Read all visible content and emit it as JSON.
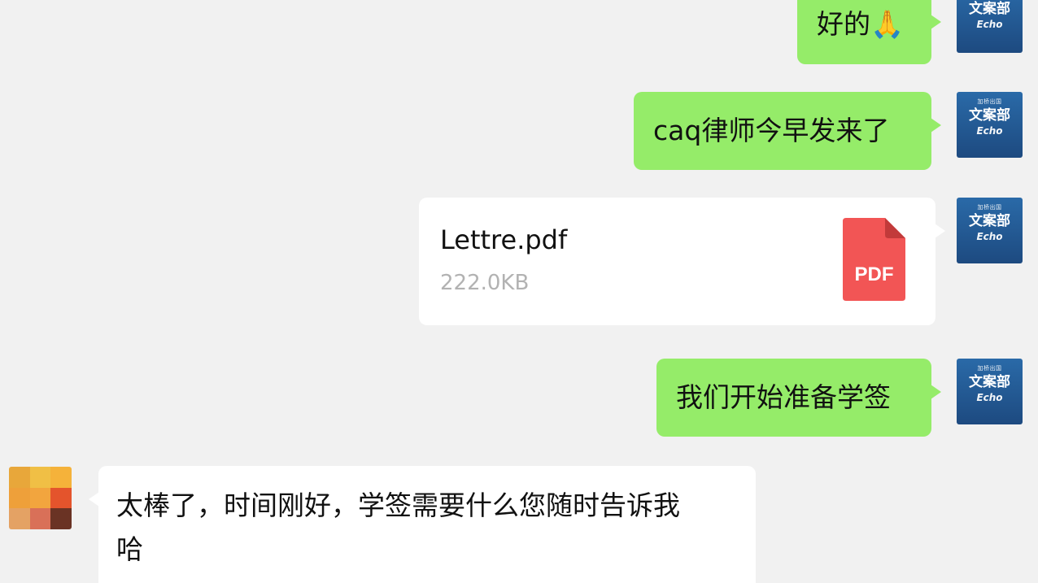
{
  "messages": {
    "m1": {
      "text": "好的",
      "emoji": "🙏"
    },
    "m2": {
      "text": "caq律师今早发来了"
    },
    "m3": {
      "file_name": "Lettre.pdf",
      "file_size": "222.0KB",
      "file_type": "PDF"
    },
    "m4": {
      "text": "我们开始准备学签"
    },
    "m5": {
      "line1": "太棒了，时间刚好，学签需要什么您随时告诉我",
      "line2": "哈"
    }
  },
  "self_avatar": {
    "brand": "加桥出国",
    "dept": "文案部",
    "name": "Echo",
    "color": "#1d4a80"
  },
  "colors": {
    "background": "#f1f1f1",
    "self_bubble": "#95ec69",
    "other_bubble": "#ffffff",
    "pdf_icon": "#f25555",
    "file_size_text": "#b2b2b2"
  },
  "other_avatar": {
    "pixels": [
      "#e8a73a",
      "#f0bf45",
      "#f5b23a",
      "#eea03a",
      "#f2a53e",
      "#e4542c",
      "#e4a264",
      "#d97058",
      "#6a3324"
    ]
  }
}
